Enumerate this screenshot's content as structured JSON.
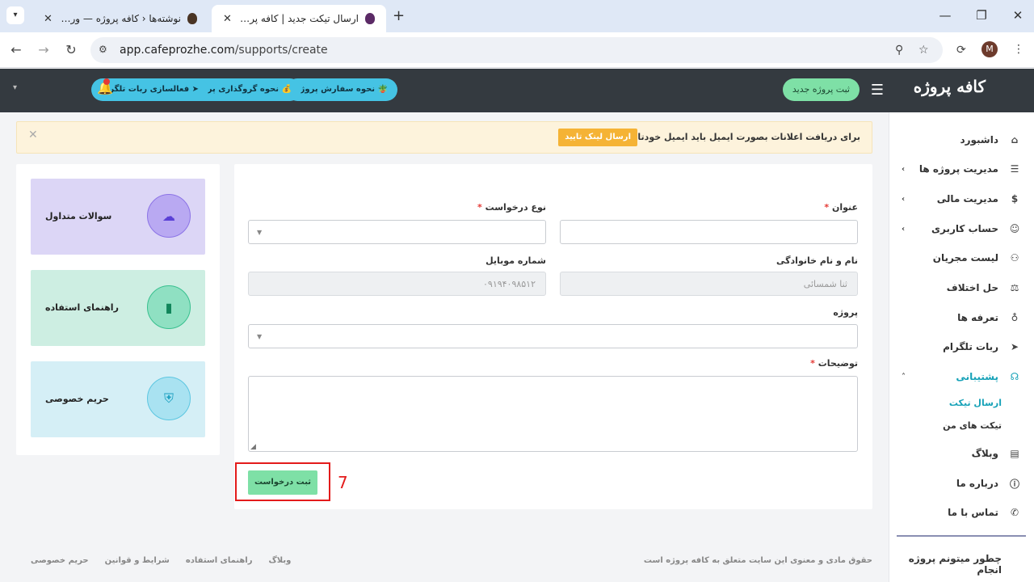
{
  "browser": {
    "tabs": [
      {
        "title": "نوشته‌ها ‹ کافه پروژه — وردپرس",
        "active": false
      },
      {
        "title": "ارسال تیکت جدید | کافه پروژه",
        "active": true
      }
    ],
    "url_host": "app.cafeprozhe.com",
    "url_path": "/supports/create",
    "profile_initial": "M"
  },
  "header": {
    "logo": "کافه پروژه",
    "new_project": "ثبت پروژه جدید",
    "order_guide": "نحوه سفارش پروژه",
    "deposit_guide": "نحوه گروگذاری پروژه",
    "telegram_bot": "فعالسازی ربات تلگرام"
  },
  "sidebar": {
    "items": [
      {
        "label": "داشبورد",
        "icon": "home-icon"
      },
      {
        "label": "مدیریت پروژه ها",
        "icon": "list-icon"
      },
      {
        "label": "مدیریت مالی",
        "icon": "dollar-icon"
      },
      {
        "label": "حساب کاربری",
        "icon": "user-icon"
      },
      {
        "label": "لیست مجریان",
        "icon": "users-icon"
      },
      {
        "label": "حل اختلاف",
        "icon": "scale-icon"
      },
      {
        "label": "تعرفه ها",
        "icon": "award-icon"
      },
      {
        "label": "ربات تلگرام",
        "icon": "telegram-icon"
      },
      {
        "label": "پشتیبانی",
        "icon": "headset-icon"
      },
      {
        "label": "وبلاگ",
        "icon": "blog-icon"
      },
      {
        "label": "درباره ما",
        "icon": "info-icon"
      },
      {
        "label": "تماس با ما",
        "icon": "phone-icon"
      }
    ],
    "support_sub": [
      "ارسال تیکت",
      "تیکت های من"
    ],
    "bottom_link": "چطور میتونم پروژه انجام"
  },
  "alert": {
    "text": "برای دریافت اعلانات بصورت ایمیل باید ایمیل خودتان را تایید کنید.",
    "button": "ارسال لینک تایید"
  },
  "cards": {
    "faq": "سوالات متداول",
    "guide": "راهنمای استفاده",
    "privacy": "حریم خصوصی"
  },
  "form": {
    "title_label": "عنوان",
    "type_label": "نوع درخواست",
    "name_label": "نام و نام خانوادگی",
    "name_value": "ثنا شمسائی",
    "mobile_label": "شماره موبایل",
    "mobile_value": "۰۹۱۹۴۰۹۸۵۱۲",
    "project_label": "پروژه",
    "desc_label": "توضیحات",
    "submit": "ثبت درخواست"
  },
  "annotation": {
    "step": "7"
  },
  "footer": {
    "copyright": "حقوق مادی و معنوی این سایت متعلق به کافه پروژه است",
    "links": [
      "وبلاگ",
      "راهنمای استفاده",
      "شرایط و قوانین",
      "حریم خصوصی"
    ]
  }
}
